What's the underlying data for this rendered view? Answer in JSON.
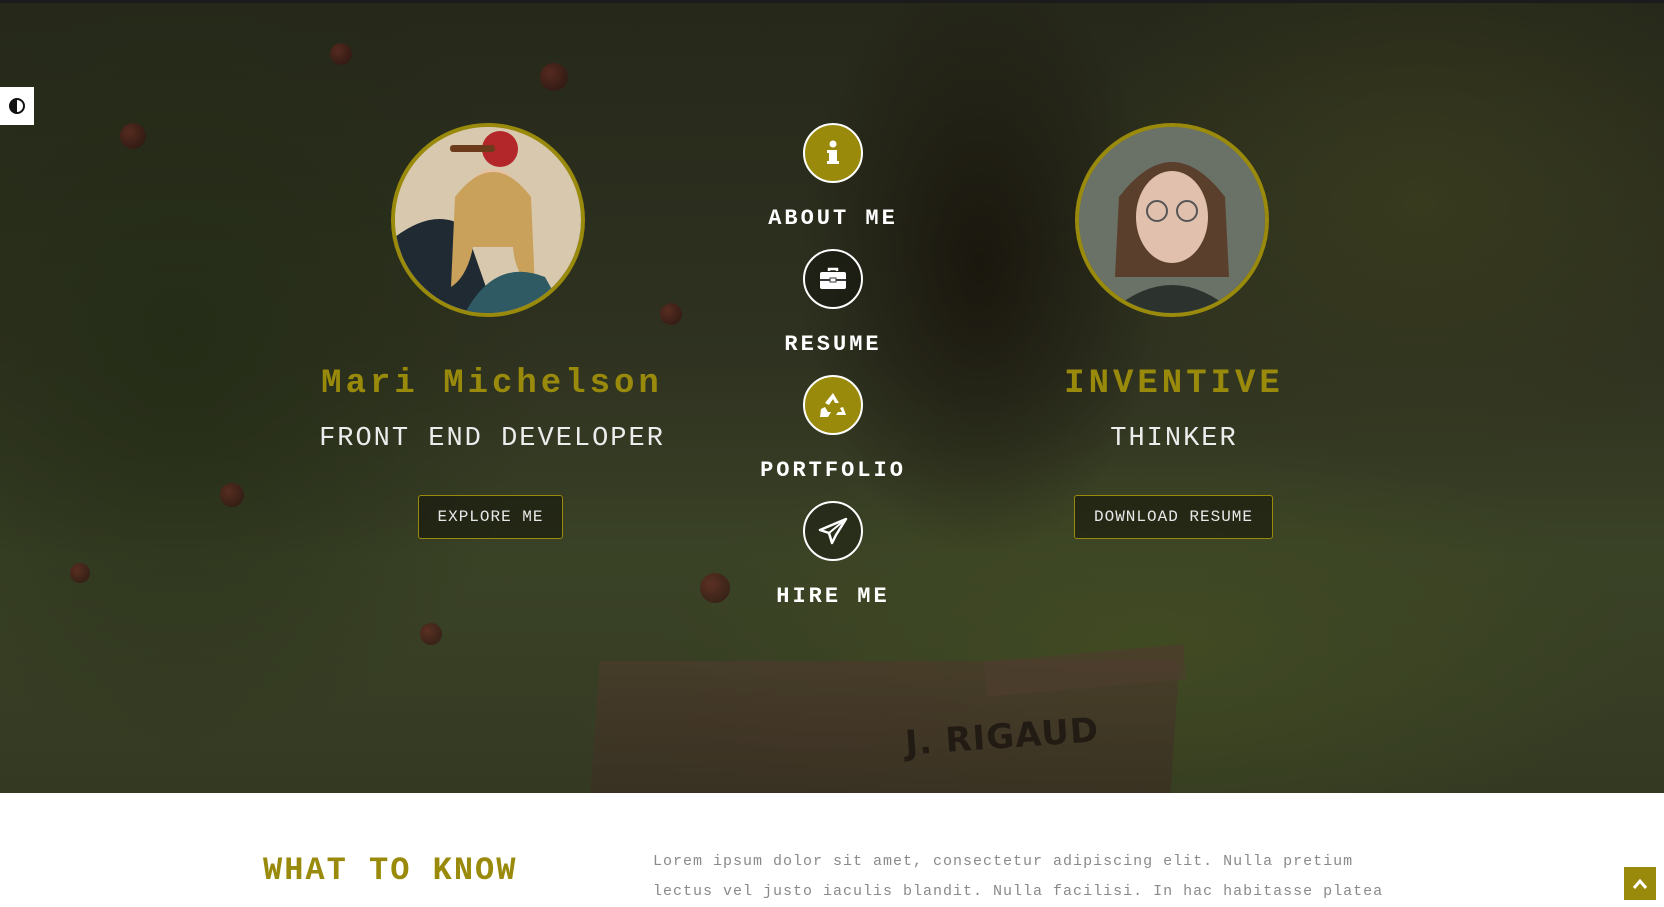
{
  "accent_color": "#9a8a0c",
  "contrast_toggle": {
    "icon": "contrast-icon"
  },
  "hero": {
    "left": {
      "name": "Mari Michelson",
      "role": "FRONT END DEVELOPER",
      "button_label": "EXPLORE ME"
    },
    "right": {
      "title": "INVENTIVE",
      "subtitle": "THINKER",
      "button_label": "DOWNLOAD RESUME"
    },
    "nav": [
      {
        "label": "ABOUT ME",
        "icon": "info-icon"
      },
      {
        "label": "RESUME",
        "icon": "briefcase-icon"
      },
      {
        "label": "PORTFOLIO",
        "icon": "recycle-icon"
      },
      {
        "label": "HIRE ME",
        "icon": "paper-plane-icon"
      }
    ],
    "background_sign": "J. RIGAUD"
  },
  "about": {
    "heading": "WHAT TO KNOW",
    "body": "Lorem ipsum dolor sit amet, consectetur adipiscing elit. Nulla pretium lectus vel justo iaculis blandit. Nulla facilisi. In hac habitasse platea"
  },
  "scroll_top": {
    "icon": "chevron-up-icon"
  }
}
